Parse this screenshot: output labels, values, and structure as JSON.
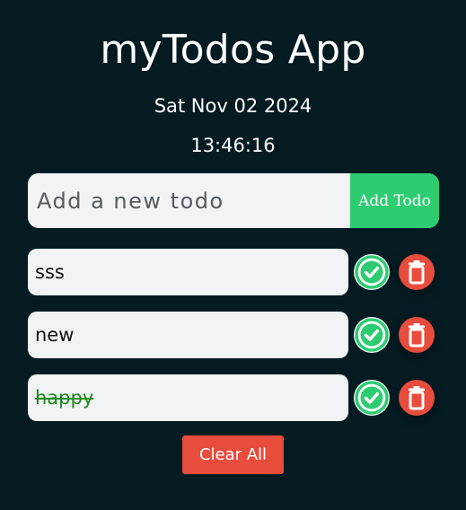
{
  "app": {
    "title": "myTodos App",
    "date": "Sat Nov 02 2024",
    "time": "13:46:16"
  },
  "add": {
    "placeholder": "Add a new todo",
    "button_label": "Add Todo"
  },
  "todos": [
    {
      "text": "sss",
      "completed": false,
      "check_icon": "check-circle-icon",
      "delete_icon": "trash-icon"
    },
    {
      "text": "new",
      "completed": false,
      "check_icon": "check-circle-icon",
      "delete_icon": "trash-icon"
    },
    {
      "text": "happy",
      "completed": true,
      "check_icon": "check-circle-icon",
      "delete_icon": "trash-icon"
    }
  ],
  "footer": {
    "clear_label": "Clear All"
  },
  "colors": {
    "background": "#041b22",
    "accent_green": "#2ecc71",
    "danger_red": "#e74c3c",
    "completed_text": "#1c8a1c"
  }
}
